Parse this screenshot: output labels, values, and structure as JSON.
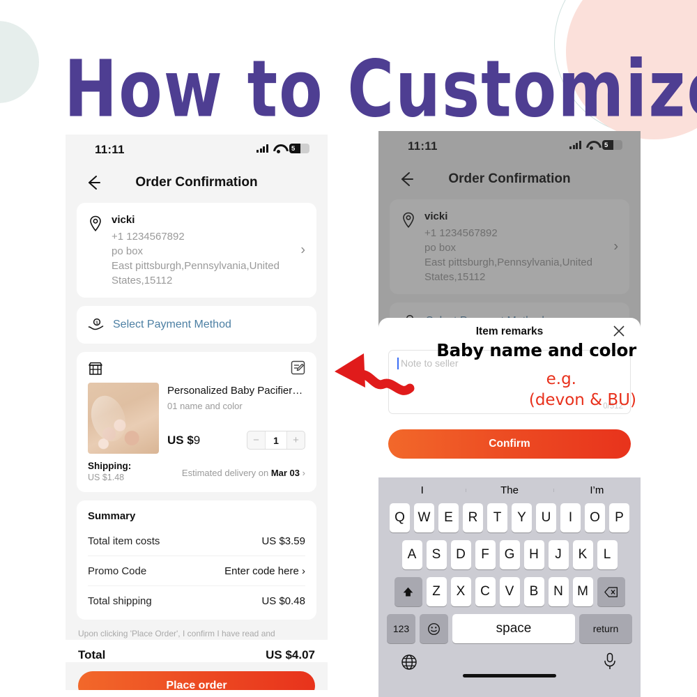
{
  "headline": "How to Customize",
  "colors": {
    "headline_purple": "#4e3e92",
    "accent_orange": "#ec4a22",
    "link_blue": "#4c7fa3",
    "arrow_red": "#e01b1b",
    "peach_circle": "#fbe0da",
    "mint_circle": "#e6eeec"
  },
  "phone_left": {
    "status": {
      "time": "11:11",
      "battery": "5",
      "signal_icon": "signal-bars-icon",
      "wifi_icon": "wifi-icon",
      "battery_icon": "battery-icon"
    },
    "nav": {
      "back_icon": "back-arrow-icon",
      "title": "Order Confirmation"
    },
    "address": {
      "pin_icon": "location-pin-icon",
      "name": "vicki",
      "phone": "+1 1234567892",
      "line1": "po box",
      "line2": "East pittsburgh,Pennsylvania,United",
      "line3": "States,15112",
      "chevron": "›"
    },
    "payment": {
      "icon": "payment-hand-coin-icon",
      "label": "Select Payment Method"
    },
    "item": {
      "store_icon": "store-icon",
      "edit_icon": "edit-note-icon",
      "title": "Personalized Baby Pacifier Clip Custo…",
      "variant": "01 name and color",
      "price_currency": "US $",
      "price_value": "9",
      "qty_minus": "−",
      "qty_value": "1",
      "qty_plus": "+",
      "shipping_label": "Shipping:",
      "shipping_value": "US $1.48",
      "delivery_prefix": "Estimated delivery on ",
      "delivery_date": "Mar 03",
      "delivery_chevron": "›"
    },
    "summary": {
      "title": "Summary",
      "rows": [
        {
          "label": "Total item costs",
          "value": "US $3.59"
        },
        {
          "label": "Promo Code",
          "value": "Enter code here ›"
        },
        {
          "label": "Total shipping",
          "value": "US $0.48"
        }
      ]
    },
    "disclaimer": "Upon clicking 'Place Order', I confirm I have read and",
    "total": {
      "label": "Total",
      "value": "US $4.07"
    },
    "cta": "Place order"
  },
  "phone_right": {
    "status": {
      "time": "11:11",
      "battery": "5"
    },
    "nav": {
      "title": "Order Confirmation"
    },
    "address": {
      "name": "vicki",
      "phone": "+1 1234567892",
      "line1": "po box",
      "line2": "East pittsburgh,Pennsylvania,United",
      "line3": "States,15112",
      "chevron": "›"
    },
    "payment": {
      "label": "Select Payment Method"
    },
    "sheet": {
      "title": "Item remarks",
      "close_icon": "close-icon",
      "textarea_placeholder": "Note to seller",
      "counter": "0/512",
      "confirm": "Confirm"
    },
    "annotation": {
      "heading": "Baby name and color",
      "example_label": "e.g.",
      "example_value": "(devon & BU)"
    },
    "keyboard": {
      "suggestions": [
        "I",
        "The",
        "I’m"
      ],
      "row1": [
        "Q",
        "W",
        "E",
        "R",
        "T",
        "Y",
        "U",
        "I",
        "O",
        "P"
      ],
      "row2": [
        "A",
        "S",
        "D",
        "F",
        "G",
        "H",
        "J",
        "K",
        "L"
      ],
      "row3": [
        "Z",
        "X",
        "C",
        "V",
        "B",
        "N",
        "M"
      ],
      "shift_icon": "shift-up-icon",
      "backspace_icon": "backspace-icon",
      "numbers_key": "123",
      "emoji_icon": "emoji-smiley-icon",
      "space_key": "space",
      "return_key": "return",
      "globe_icon": "globe-icon",
      "mic_icon": "microphone-icon"
    }
  }
}
